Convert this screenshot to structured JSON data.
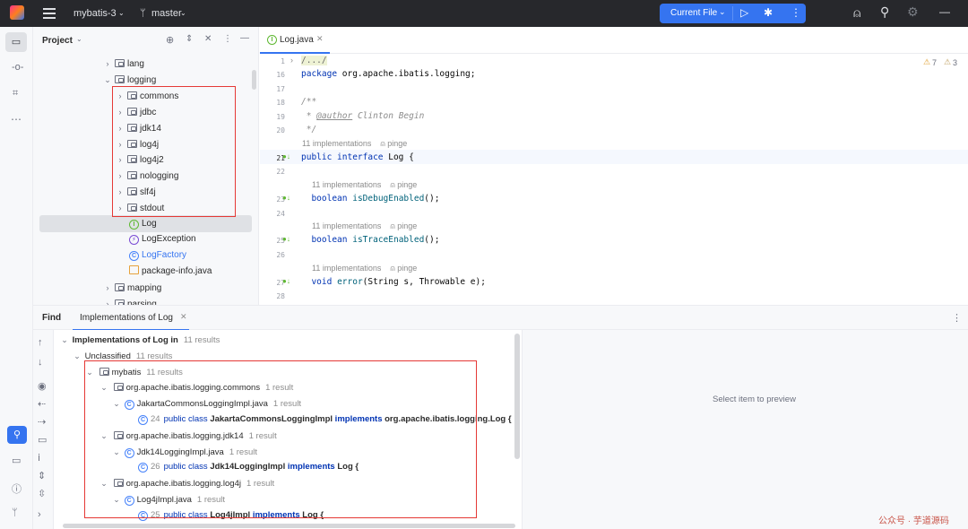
{
  "titlebar": {
    "project": "mybatis-3",
    "branch": "master",
    "run_config": "Current File"
  },
  "project_panel": {
    "title": "Project",
    "tree": [
      {
        "label": "lang",
        "type": "folder",
        "expanded": false
      },
      {
        "label": "logging",
        "type": "folder",
        "expanded": true
      },
      {
        "label": "commons",
        "type": "folder",
        "expanded": false
      },
      {
        "label": "jdbc",
        "type": "folder",
        "expanded": false
      },
      {
        "label": "jdk14",
        "type": "folder",
        "expanded": false
      },
      {
        "label": "log4j",
        "type": "folder",
        "expanded": false
      },
      {
        "label": "log4j2",
        "type": "folder",
        "expanded": false
      },
      {
        "label": "nologging",
        "type": "folder",
        "expanded": false
      },
      {
        "label": "slf4j",
        "type": "folder",
        "expanded": false
      },
      {
        "label": "stdout",
        "type": "folder",
        "expanded": false
      },
      {
        "label": "Log",
        "type": "interface",
        "selected": true
      },
      {
        "label": "LogException",
        "type": "exception"
      },
      {
        "label": "LogFactory",
        "type": "class"
      },
      {
        "label": "package-info.java",
        "type": "file"
      },
      {
        "label": "mapping",
        "type": "folder",
        "expanded": false
      },
      {
        "label": "parsing",
        "type": "folder",
        "expanded": false
      }
    ]
  },
  "editor": {
    "tab": "Log.java",
    "warnings": "7",
    "weak_warnings": "3",
    "lines": [
      {
        "n": "1",
        "text": "/.../"
      },
      {
        "n": "16",
        "text": "package org.apache.ibatis.logging;"
      },
      {
        "n": "17",
        "text": ""
      },
      {
        "n": "18",
        "text": "/**"
      },
      {
        "n": "19",
        "text": " * @author Clinton Begin"
      },
      {
        "n": "20",
        "text": " */"
      },
      {
        "n": "21",
        "text": "public interface Log {"
      },
      {
        "n": "22",
        "text": ""
      },
      {
        "n": "23",
        "text": "  boolean isDebugEnabled();"
      },
      {
        "n": "24",
        "text": ""
      },
      {
        "n": "25",
        "text": "  boolean isTraceEnabled();"
      },
      {
        "n": "26",
        "text": ""
      },
      {
        "n": "27",
        "text": "  void error(String s, Throwable e);"
      },
      {
        "n": "28",
        "text": ""
      }
    ],
    "hint_impl": "11 implementations",
    "hint_author": "pinge"
  },
  "find": {
    "title": "Find",
    "tab": "Implementations of Log",
    "root": "Implementations of Log in",
    "root_count": "11 results",
    "unclassified": "Unclassified",
    "unclassified_count": "11 results",
    "module": "mybatis",
    "module_count": "11 results",
    "groups": [
      {
        "package": "org.apache.ibatis.logging.commons",
        "package_count": "1 result",
        "file": "JakartaCommonsLoggingImpl.java",
        "file_count": "1 result",
        "line_no": "24",
        "line_pre": "public class ",
        "line_cls": "JakartaCommonsLoggingImpl",
        "line_mid": " implements ",
        "line_post": "org.apache.ibatis.logging.Log {"
      },
      {
        "package": "org.apache.ibatis.logging.jdk14",
        "package_count": "1 result",
        "file": "Jdk14LoggingImpl.java",
        "file_count": "1 result",
        "line_no": "26",
        "line_pre": "public class ",
        "line_cls": "Jdk14LoggingImpl",
        "line_mid": " implements ",
        "line_post": "Log {"
      },
      {
        "package": "org.apache.ibatis.logging.log4j",
        "package_count": "1 result",
        "file": "Log4jImpl.java",
        "file_count": "1 result",
        "line_no": "25",
        "line_pre": "public class ",
        "line_cls": "Log4jImpl",
        "line_mid": " implements ",
        "line_post": "Log {"
      }
    ],
    "preview_text": "Select item to preview"
  },
  "watermark": "公众号 · 芋道源码",
  "colors": {
    "accent": "#3574f0",
    "highlight": "#e53935",
    "keyword": "#0033b3"
  }
}
